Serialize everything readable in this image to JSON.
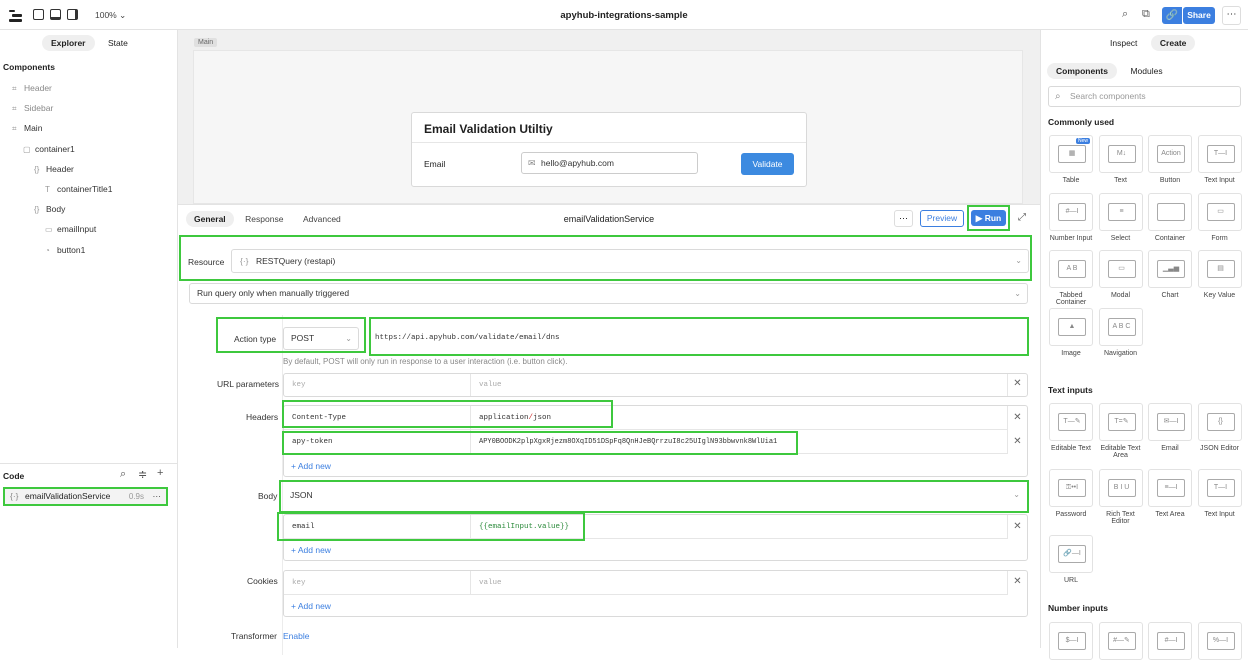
{
  "topbar": {
    "zoom": "100%",
    "title": "apyhub-integrations-sample",
    "share": "Share"
  },
  "left": {
    "tabs": [
      "Explorer",
      "State"
    ],
    "components_label": "Components",
    "tree": [
      {
        "label": "Header",
        "indent": 0,
        "dim": true,
        "icon": "frame-icon"
      },
      {
        "label": "Sidebar",
        "indent": 0,
        "dim": true,
        "icon": "frame-icon"
      },
      {
        "label": "Main",
        "indent": 0,
        "dim": false,
        "icon": "frame-icon"
      },
      {
        "label": "container1",
        "indent": 1,
        "dim": false,
        "icon": "container-icon"
      },
      {
        "label": "Header",
        "indent": 2,
        "dim": false,
        "icon": "braces-icon"
      },
      {
        "label": "containerTitle1",
        "indent": 3,
        "dim": false,
        "icon": "text-icon"
      },
      {
        "label": "Body",
        "indent": 2,
        "dim": false,
        "icon": "braces-icon"
      },
      {
        "label": "emailInput",
        "indent": 3,
        "dim": false,
        "icon": "input-icon"
      },
      {
        "label": "button1",
        "indent": 3,
        "dim": false,
        "icon": "button-icon"
      }
    ],
    "code_label": "Code",
    "query": {
      "name": "emailValidationService",
      "time": "0.9s"
    }
  },
  "canvas": {
    "tag": "Main",
    "card_title": "Email Validation Utiltiy",
    "email_label": "Email",
    "email_value": "hello@apyhub.com",
    "validate": "Validate"
  },
  "editor": {
    "tabs": [
      "General",
      "Response",
      "Advanced"
    ],
    "query_name": "emailValidationService",
    "preview": "Preview",
    "run": "Run",
    "resource_label": "Resource",
    "resource_value": "RESTQuery (restapi)",
    "trigger": "Run query only when manually triggered",
    "action_label": "Action type",
    "method": "POST",
    "url": "https://api.apyhub.com/validate/email/dns",
    "hint": "By default, POST will only run in response to a user interaction (i.e. button click).",
    "url_params_label": "URL parameters",
    "key_ph": "key",
    "value_ph": "value",
    "headers_label": "Headers",
    "headers": [
      {
        "key": "Content-Type",
        "value_a": "application",
        "value_sep": "/",
        "value_b": "json"
      },
      {
        "key": "apy-token",
        "value": "APY0BOODK2plpXgxRjezm8OXqID51DSpFq8QnHJeBQrrzuI8c25UIglN93bbwvnk8WlUia1"
      }
    ],
    "add_new": "+ Add new",
    "body_label": "Body",
    "body_type": "JSON",
    "body": [
      {
        "key": "email",
        "value": "{{emailInput.value}}"
      }
    ],
    "cookies_label": "Cookies",
    "transformer_label": "Transformer",
    "transformer_value": "Enable"
  },
  "right": {
    "tabs": [
      "Inspect",
      "Create"
    ],
    "subtabs": [
      "Components",
      "Modules"
    ],
    "search_ph": "Search components",
    "commonly_used": "Commonly used",
    "common": [
      {
        "label": "Table",
        "glyph": "▦",
        "badge": "New"
      },
      {
        "label": "Text",
        "glyph": "M↓"
      },
      {
        "label": "Button",
        "glyph": "Action"
      },
      {
        "label": "Text Input",
        "glyph": "T—I"
      },
      {
        "label": "Number Input",
        "glyph": "#—I"
      },
      {
        "label": "Select",
        "glyph": "≡"
      },
      {
        "label": "Container",
        "glyph": ""
      },
      {
        "label": "Form",
        "glyph": "▭"
      },
      {
        "label": "Tabbed Container",
        "glyph": "A B"
      },
      {
        "label": "Modal",
        "glyph": "▭"
      },
      {
        "label": "Chart",
        "glyph": "▁▃▅"
      },
      {
        "label": "Key Value",
        "glyph": "▤"
      },
      {
        "label": "Image",
        "glyph": "▲"
      },
      {
        "label": "Navigation",
        "glyph": "A B C"
      }
    ],
    "text_inputs": "Text inputs",
    "text_comps": [
      {
        "label": "Editable Text",
        "glyph": "T—✎"
      },
      {
        "label": "Editable Text Area",
        "glyph": "T=✎"
      },
      {
        "label": "Email",
        "glyph": "✉—I"
      },
      {
        "label": "JSON Editor",
        "glyph": "{}"
      },
      {
        "label": "Password",
        "glyph": "⚿••I"
      },
      {
        "label": "Rich Text Editor",
        "glyph": "B I U"
      },
      {
        "label": "Text Area",
        "glyph": "≡—I"
      },
      {
        "label": "Text Input",
        "glyph": "T—I"
      },
      {
        "label": "URL",
        "glyph": "🔗—I"
      }
    ],
    "number_inputs": "Number inputs",
    "number_comps": [
      {
        "glyph": "$—I"
      },
      {
        "glyph": "#—✎"
      },
      {
        "glyph": "#—I"
      },
      {
        "glyph": "%—I"
      }
    ]
  }
}
